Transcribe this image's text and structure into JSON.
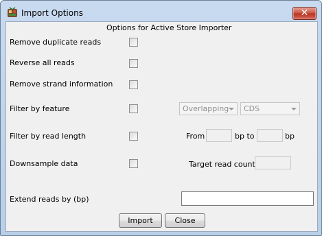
{
  "window": {
    "title": "Import Options",
    "close_symbol": "✕",
    "icon": "app-icon"
  },
  "header": "Options for Active Store Importer",
  "options": {
    "remove_duplicates": "Remove duplicate reads",
    "reverse": "Reverse all reads",
    "remove_strand": "Remove strand information",
    "filter_feature": "Filter by feature",
    "filter_length": "Filter by read length",
    "downsample": "Downsample data",
    "extend": "Extend reads by (bp)"
  },
  "feature": {
    "overlap_value": "Overlapping",
    "type_value": "CDS"
  },
  "length": {
    "from_label": "From",
    "to_label": "bp to",
    "bp_label": "bp",
    "from_value": "",
    "to_value": ""
  },
  "downsample_target": {
    "label": "Target read count",
    "value": ""
  },
  "extend_value": "",
  "buttons": {
    "import": "Import",
    "close": "Close"
  }
}
